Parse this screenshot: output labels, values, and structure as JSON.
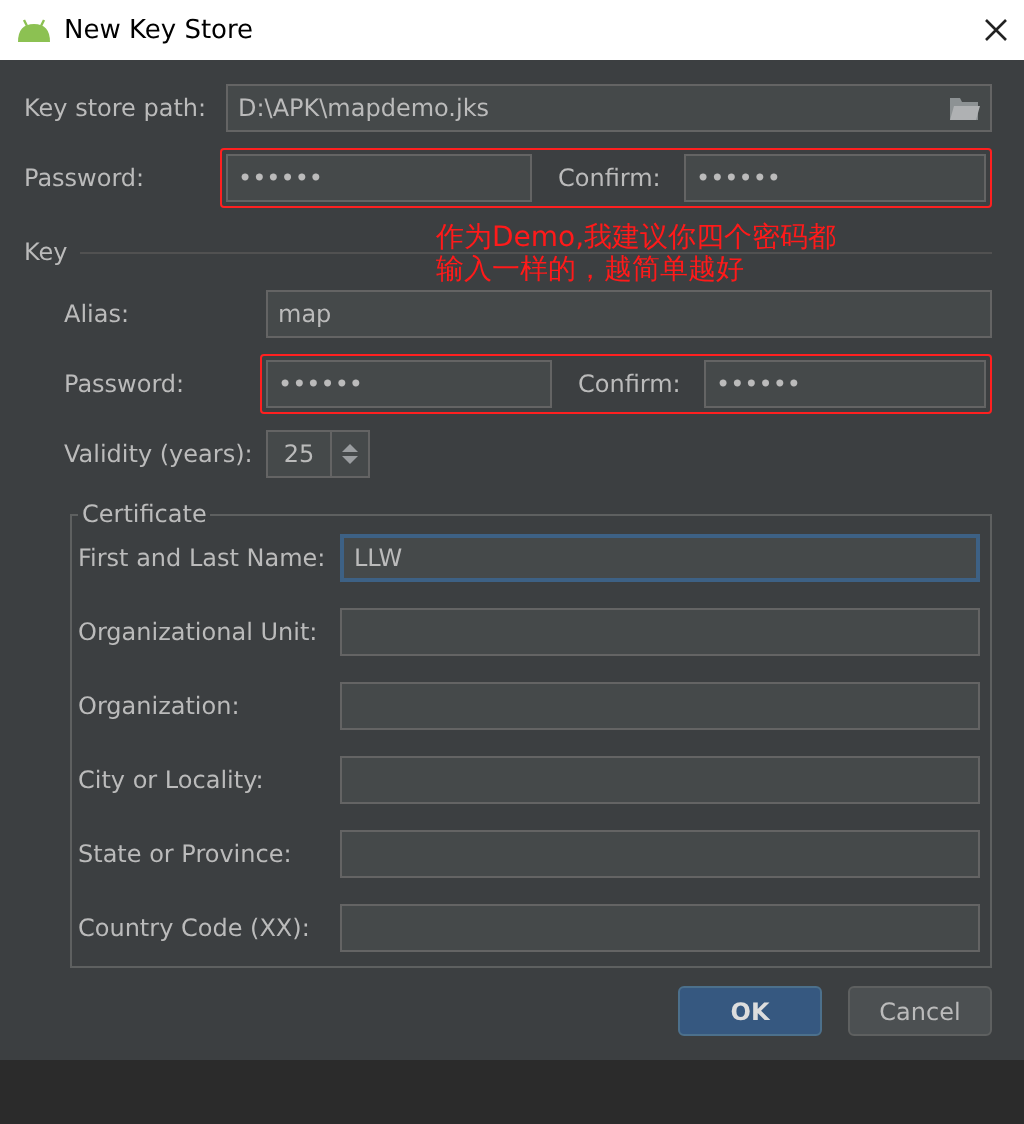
{
  "window": {
    "title": "New Key Store"
  },
  "key_store_path": {
    "label": "Key store path:",
    "value": "D:\\APK\\mapdemo.jks"
  },
  "store_password": {
    "label": "Password:",
    "value": "••••••",
    "confirm_label": "Confirm:",
    "confirm_value": "••••••",
    "highlighted": true
  },
  "key": {
    "title": "Key",
    "alias": {
      "label": "Alias:",
      "value": "map"
    },
    "password": {
      "label": "Password:",
      "value": "••••••",
      "confirm_label": "Confirm:",
      "confirm_value": "••••••",
      "highlighted": true
    },
    "validity": {
      "label": "Validity (years):",
      "value": "25"
    },
    "certificate": {
      "title": "Certificate",
      "fields": [
        {
          "label": "First and Last Name:",
          "value": "LLW",
          "focused": true
        },
        {
          "label": "Organizational Unit:",
          "focused": false
        },
        {
          "label": "Organization:",
          "focused": false
        },
        {
          "label": "City or Locality:",
          "focused": false
        },
        {
          "label": "State or Province:",
          "focused": false
        },
        {
          "label": "Country Code (XX):",
          "focused": false
        }
      ]
    }
  },
  "annotation": {
    "lines": [
      "作为Demo,我建议你四个密码都",
      "输入一样的，越简单越好"
    ]
  },
  "buttons": [
    {
      "label": "OK",
      "kind": "default"
    },
    {
      "label": "Cancel",
      "kind": "normal"
    }
  ]
}
